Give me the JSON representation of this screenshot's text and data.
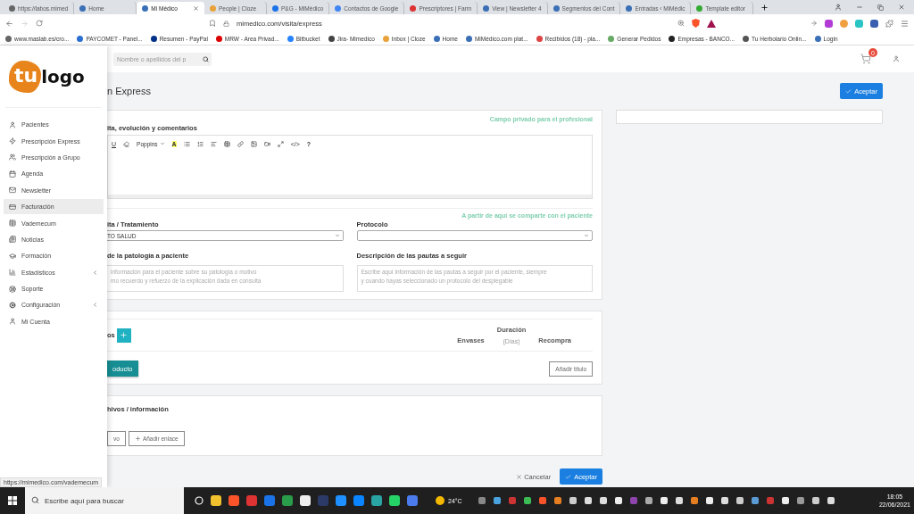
{
  "browser": {
    "tabs": [
      {
        "label": "https://labos.mimed",
        "selected": false
      },
      {
        "label": "Home",
        "selected": false
      },
      {
        "label": "Mi Médico",
        "selected": true
      },
      {
        "label": "People | Cloze",
        "selected": false
      },
      {
        "label": "P&G - MiMédico",
        "selected": false
      },
      {
        "label": "Contactos de Google",
        "selected": false
      },
      {
        "label": "Prescriptores | Farm",
        "selected": false
      },
      {
        "label": "View | Newsletter 4",
        "selected": false
      },
      {
        "label": "Segmentos del Cont",
        "selected": false
      },
      {
        "label": "Entradas ‹ MiMédic",
        "selected": false
      },
      {
        "label": "Template editor",
        "selected": false
      }
    ],
    "address": "mimedico.com/visita/express",
    "bookmarks": [
      "www.maslab.es/cro...",
      "PAYCOMET - Panel...",
      "Resumen - PayPal",
      "MRW - Area Privad...",
      "Bitbucket",
      "Jira- Mimedico",
      "Inbox | Cloze",
      "Home",
      "MiMédico.com plat...",
      "Recibidos (18) - pla...",
      "Generar Pedidos",
      "Empresas - BANCO...",
      "Tu Herbolario Onlin...",
      "Login"
    ],
    "status_url": "https://mimedico.com/vademecum"
  },
  "sidebar": {
    "logo": {
      "prefix": "tu",
      "name": "logo"
    },
    "items": [
      {
        "label": "Pacientes",
        "selected": false,
        "expandable": false
      },
      {
        "label": "Prescripción Express",
        "selected": false,
        "expandable": false
      },
      {
        "label": "Prescripción a Grupo",
        "selected": false,
        "expandable": false
      },
      {
        "label": "Agenda",
        "selected": false,
        "expandable": false
      },
      {
        "label": "Newsletter",
        "selected": false,
        "expandable": false
      },
      {
        "label": "Facturación",
        "selected": true,
        "expandable": false
      },
      {
        "label": "Vademecum",
        "selected": false,
        "expandable": false
      },
      {
        "label": "Noticias",
        "selected": false,
        "expandable": false
      },
      {
        "label": "Formación",
        "selected": false,
        "expandable": false
      },
      {
        "label": "Estadísticos",
        "selected": false,
        "expandable": true
      },
      {
        "label": "Soporte",
        "selected": false,
        "expandable": false
      },
      {
        "label": "Configuración",
        "selected": false,
        "expandable": true
      },
      {
        "label": "Mi Cuenta",
        "selected": false,
        "expandable": false
      }
    ]
  },
  "header": {
    "search_placeholder": "Nombre o apellidos del p",
    "cart_count": "0"
  },
  "page": {
    "title": "n Express",
    "accept": "Aceptar"
  },
  "notes": {
    "private_hint": "Campo privado para el profesional",
    "label": "ita, evolución y comentarios",
    "toolbar": {
      "underline": "U",
      "font": "Poppins",
      "highlight": "A",
      "code": "</>",
      "help": "?"
    }
  },
  "shared": {
    "hint": "A partir de aquí se comparte con el paciente",
    "visit_label": "ita / Tratamiento",
    "visit_value": "TO SALUD",
    "protocol_label": "Protocolo",
    "pathology_label": "de la patología a paciente",
    "pathology_placeholder": "información para el paciente sobre su patología o motivo\nmo recuerdo y refuerzo de la explicación dada en consulta",
    "guidelines_label": "Descripción de las pautas a seguir",
    "guidelines_placeholder": "Escribe aquí información de las pautas a seguir por el paciente, siempre\ny cuando hayas seleccionado un protocolo del desplegable"
  },
  "products": {
    "label": "os",
    "columns": [
      "Envases",
      "Duración",
      "(Días)",
      "Recompra"
    ],
    "add_product": "oducto",
    "add_title": "Añadir título"
  },
  "files": {
    "label": "hivos / información",
    "add_file": "vo",
    "add_link": "Añadir enlace"
  },
  "footer": {
    "cancel": "Cancelar",
    "accept": "Aceptar"
  },
  "taskbar": {
    "search_placeholder": "Escribe aquí para buscar",
    "weather": "24°C",
    "time": "18:05",
    "date": "22/06/2021"
  }
}
